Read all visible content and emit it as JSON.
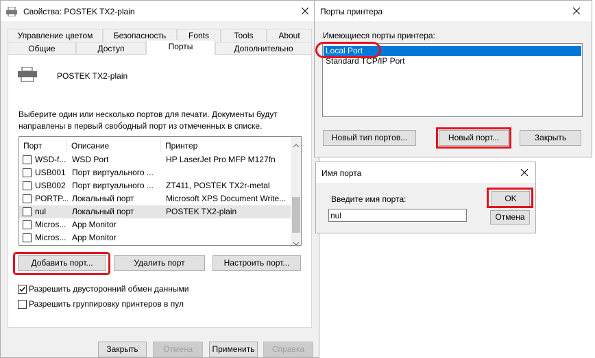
{
  "props": {
    "title": "Свойства: POSTEK TX2-plain",
    "tabs_row1": [
      "Управление цветом",
      "Безопасность",
      "Fonts",
      "Tools",
      "About"
    ],
    "tabs_row2": [
      "Общие",
      "Доступ",
      "Порты",
      "Дополнительно"
    ],
    "printer_name": "POSTEK TX2-plain",
    "description_line1": "Выберите один или несколько портов для печати. Документы будут",
    "description_line2": "направлены в первый свободный порт из отмеченных в списке.",
    "columns": [
      "Порт",
      "Описание",
      "Принтер"
    ],
    "rows": [
      {
        "port": "WSD-f...",
        "desc": "WSD Port",
        "printer": "HP LaserJet Pro MFP M127fn",
        "checked": false,
        "highlight": false
      },
      {
        "port": "USB001",
        "desc": "Порт виртуального ...",
        "printer": "",
        "checked": false,
        "highlight": false
      },
      {
        "port": "USB002",
        "desc": "Порт виртуального ...",
        "printer": "ZT411, POSTEK TX2r-metal",
        "checked": false,
        "highlight": false
      },
      {
        "port": "PORTP...",
        "desc": "Локальный порт",
        "printer": "Microsoft XPS Document Write...",
        "checked": false,
        "highlight": false
      },
      {
        "port": "nul",
        "desc": "Локальный порт",
        "printer": "POSTEK TX2-plain",
        "checked": false,
        "highlight": true
      },
      {
        "port": "Micros...",
        "desc": "App Monitor",
        "printer": "",
        "checked": false,
        "highlight": false
      },
      {
        "port": "Micros...",
        "desc": "App Monitor",
        "printer": "",
        "checked": false,
        "highlight": false
      }
    ],
    "add_port": "Добавить порт...",
    "delete_port": "Удалить порт",
    "configure_port": "Настроить порт...",
    "bidi_label": "Разрешить двусторонний обмен данными",
    "bidi_checked": true,
    "pool_label": "Разрешить группировку принтеров в пул",
    "pool_checked": false,
    "footer": {
      "close": "Закрыть",
      "cancel": "Отмена",
      "apply": "Применить",
      "help": "Справка"
    }
  },
  "ports_dialog": {
    "title": "Порты принтера",
    "label": "Имеющиеся порты принтера:",
    "items": [
      "Local Port",
      "Standard TCP/IP Port"
    ],
    "selected_index": 0,
    "new_type_button": "Новый тип портов...",
    "new_port_button": "Новый порт...",
    "close_button": "Закрыть"
  },
  "name_dialog": {
    "title": "Имя порта",
    "label": "Введите имя порта:",
    "input_value": "nul",
    "ok_button": "OK",
    "cancel_button": "Отмена"
  },
  "colors": {
    "accent": "#0078d7",
    "highlight_red": "#e0141e",
    "row_highlight": "#e5e5e5"
  }
}
